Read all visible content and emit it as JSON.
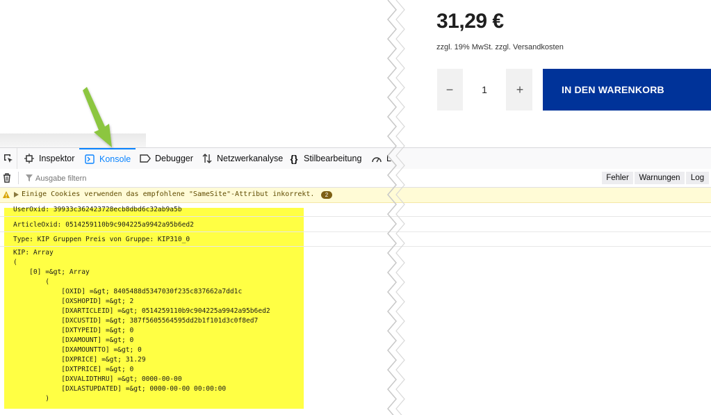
{
  "product": {
    "price": "31,29 €",
    "tax_note": "zzgl. 19% MwSt. zzgl. Versandkosten",
    "quantity": "1",
    "minus_label": "−",
    "plus_label": "+",
    "cart_button": "IN DEN WARENKORB",
    "cart_color": "#003399"
  },
  "devtools": {
    "tabs": [
      {
        "label": "Inspektor",
        "icon": "inspector-icon"
      },
      {
        "label": "Konsole",
        "icon": "console-icon",
        "active": true
      },
      {
        "label": "Debugger",
        "icon": "debugger-icon"
      },
      {
        "label": "Netzwerkanalyse",
        "icon": "network-icon"
      },
      {
        "label": "Stilbearbeitung",
        "icon": "style-editor-icon"
      },
      {
        "label": "L",
        "icon": "performance-icon"
      }
    ],
    "accent": "#0a84ff",
    "filter_placeholder": "Ausgabe filtern",
    "levels": [
      "Fehler",
      "Warnungen",
      "Log"
    ],
    "warning": {
      "text": "Einige Cookies verwenden das empfohlene \"SameSite\"-Attribut inkorrekt.",
      "count": "2"
    },
    "log_lines": [
      "UserOxid: 39933c362423728ecb8dbd6c32ab9a5b",
      "ArticleOxid: 0514259110b9c904225a9942a95b6ed2",
      "Type: KIP Gruppen Preis von Gruppe: KIP310_0"
    ],
    "array_dump": "KIP: Array\n(\n    [0] =&gt; Array\n        (\n            [OXID] =&gt; 8405488d5347030f235c837662a7dd1c\n            [OXSHOPID] =&gt; 2\n            [DXARTICLEID] =&gt; 0514259110b9c904225a9942a95b6ed2\n            [DXCUSTID] =&gt; 387f5605564595dd2b1f101d3c0f8ed7\n            [DXTYPEID] =&gt; 0\n            [DXAMOUNT] =&gt; 0\n            [DXAMOUNTTO] =&gt; 0\n            [DXPRICE] =&gt; 31.29\n            [DXTPRICE] =&gt; 0\n            [DXVALIDTHRU] =&gt; 0000-00-00\n            [DXLASTUPDATED] =&gt; 0000-00-00 00:00:00\n        )",
    "highlight_color": "#ffff44"
  }
}
